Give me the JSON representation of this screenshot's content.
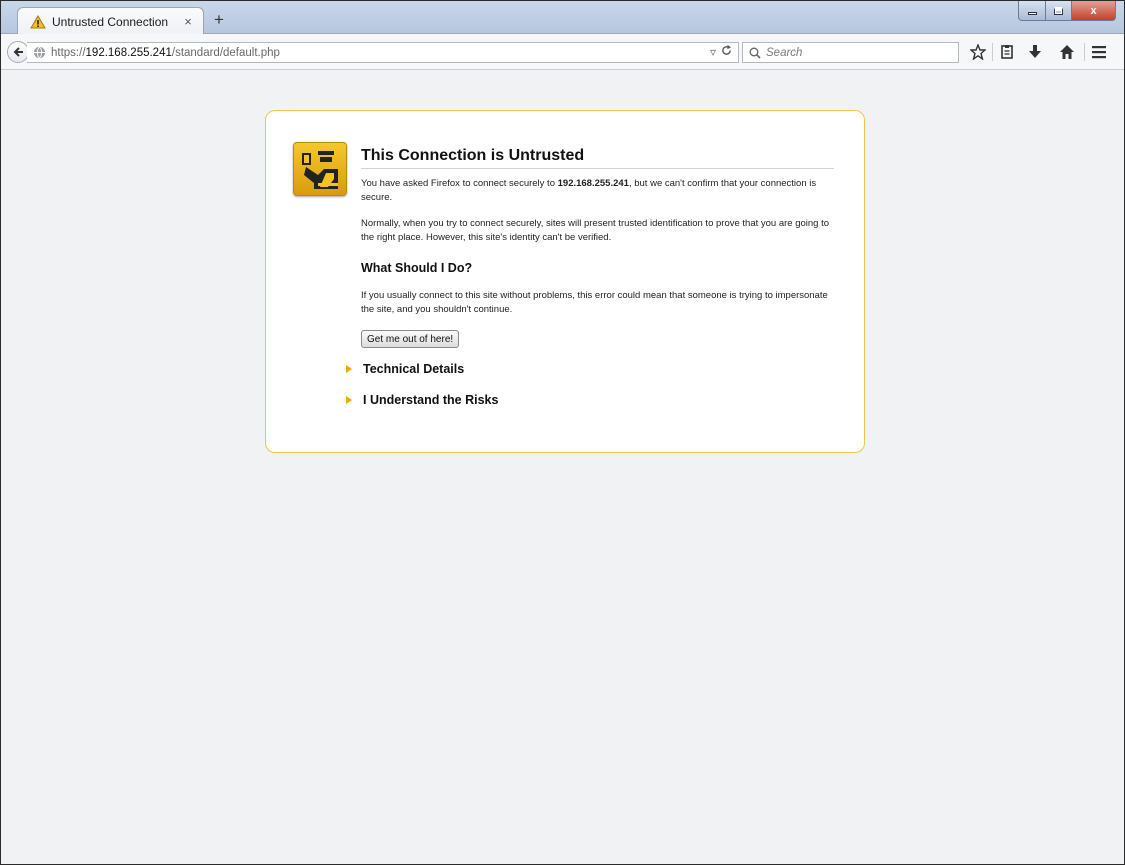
{
  "browser": {
    "tab": {
      "title": "Untrusted Connection",
      "close_glyph": "×",
      "icon": "warning-icon"
    },
    "new_tab_glyph": "+",
    "window_controls": {
      "close_glyph": "x"
    },
    "url": {
      "scheme": "https://",
      "host": "192.168.255.241",
      "path": "/standard/default.php"
    },
    "search": {
      "placeholder": "Search"
    },
    "toolbar_icons": [
      "bookmark-star-icon",
      "reading-list-icon",
      "download-icon",
      "home-icon",
      "menu-icon"
    ]
  },
  "error_page": {
    "title": "This Connection is Untrusted",
    "p1_before": "You have asked Firefox to connect securely to ",
    "p1_host": "192.168.255.241",
    "p1_after": ", but we can't confirm that your connection is secure.",
    "p2": "Normally, when you try to connect securely, sites will present trusted identification to prove that you are going to the right place. However, this site's identity can't be verified.",
    "subtitle": "What Should I Do?",
    "p3": "If you usually connect to this site without problems, this error could mean that someone is trying to impersonate the site, and you shouldn't continue.",
    "button": "Get me out of here!",
    "expander_technical": "Technical Details",
    "expander_risks": "I Understand the Risks",
    "accent_color": "#f0a800"
  }
}
